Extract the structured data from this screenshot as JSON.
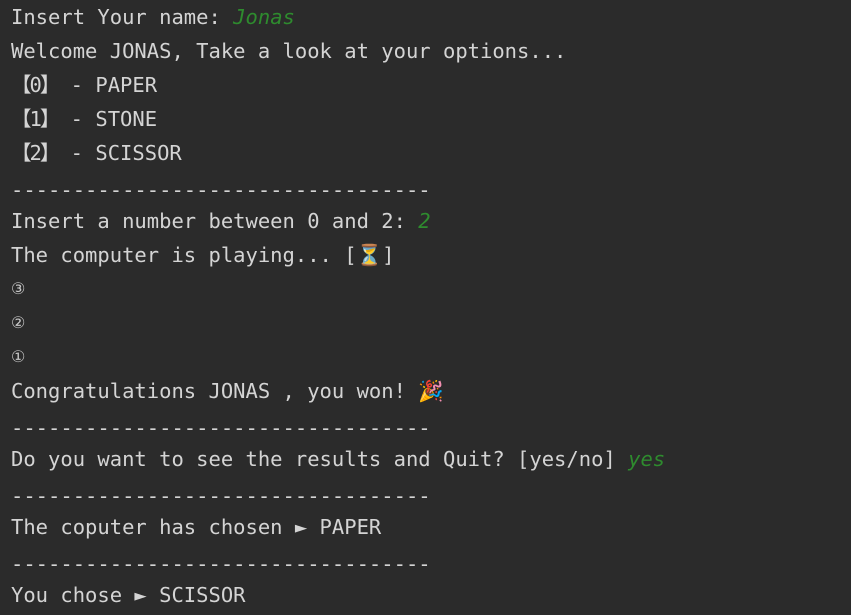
{
  "console": {
    "name_prompt": "Insert Your name: ",
    "name_input": "Jonas",
    "welcome": "Welcome JONAS, Take a look at your options...",
    "options": [
      {
        "key": "【0】",
        "text": " - PAPER"
      },
      {
        "key": "【1】",
        "text": " - STONE"
      },
      {
        "key": "【2】",
        "text": " - SCISSOR"
      }
    ],
    "separator": "----------------------------------",
    "number_prompt": "Insert a number between 0 and 2: ",
    "number_input": "2",
    "computer_playing": "The computer is playing... [⏳]",
    "countdown": [
      "③",
      "②",
      "①"
    ],
    "result": "Congratulations JONAS , you won! 🎉",
    "quit_prompt": "Do you want to see the results and Quit? [yes/no] ",
    "quit_input": "yes",
    "computer_choice": "The coputer has chosen ► PAPER",
    "player_choice": "You chose ► SCISSOR"
  }
}
